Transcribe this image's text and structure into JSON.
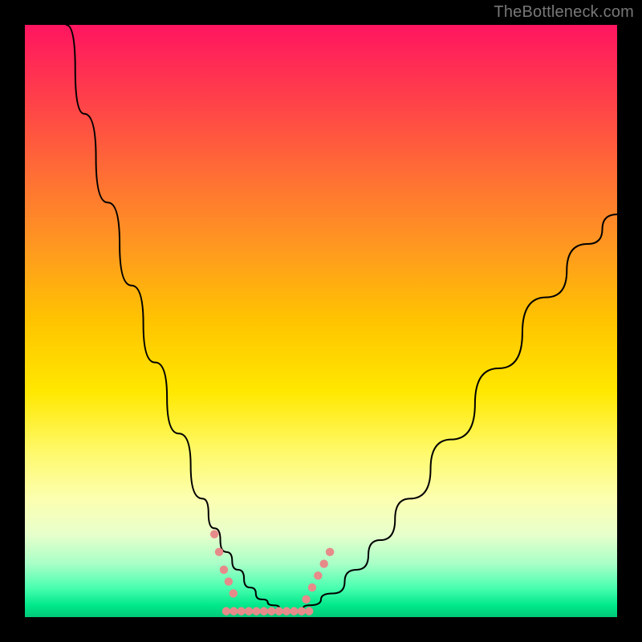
{
  "watermark": "TheBottleneck.com",
  "chart_data": {
    "type": "line",
    "title": "",
    "xlabel": "",
    "ylabel": "",
    "xlim": [
      0,
      100
    ],
    "ylim": [
      0,
      100
    ],
    "grid": false,
    "series": [
      {
        "name": "curve",
        "x": [
          7,
          10,
          14,
          18,
          22,
          26,
          30,
          32,
          34,
          36,
          38,
          40,
          42,
          44,
          46,
          48,
          52,
          56,
          60,
          65,
          72,
          80,
          88,
          95,
          100
        ],
        "values": [
          100,
          85,
          70,
          56,
          43,
          31,
          20,
          15,
          11,
          8,
          5,
          3,
          2,
          1,
          1,
          2,
          4,
          8,
          13,
          20,
          30,
          42,
          54,
          63,
          68
        ]
      }
    ],
    "dots_flat_region": {
      "x_start": 34,
      "x_end": 48,
      "y": 1,
      "count": 12
    },
    "dots_left_slope": {
      "points": [
        {
          "x": 32.0,
          "y": 14
        },
        {
          "x": 32.8,
          "y": 11
        },
        {
          "x": 33.6,
          "y": 8
        },
        {
          "x": 34.4,
          "y": 6
        },
        {
          "x": 35.2,
          "y": 4
        }
      ]
    },
    "dots_right_slope": {
      "points": [
        {
          "x": 47.5,
          "y": 3
        },
        {
          "x": 48.5,
          "y": 5
        },
        {
          "x": 49.5,
          "y": 7
        },
        {
          "x": 50.5,
          "y": 9
        },
        {
          "x": 51.5,
          "y": 11
        }
      ]
    }
  }
}
